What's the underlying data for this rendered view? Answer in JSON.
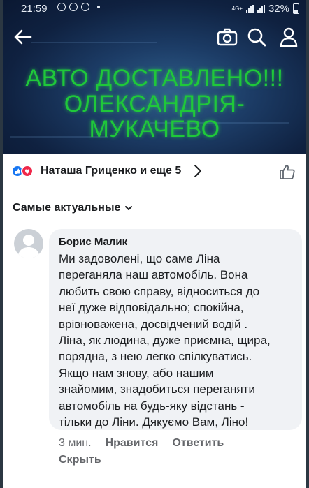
{
  "status_bar": {
    "time": "21:59",
    "network_label": "4G+",
    "battery": "32%"
  },
  "photo": {
    "line1": "АВТО  ДОСТАВЛЕНО!!!",
    "line2": "ОЛЕКСАНДРІЯ-МУКАЧЕВО",
    "text_color": "#1fc83a"
  },
  "toolbar": {
    "icons": [
      "back-arrow-icon",
      "camera-icon",
      "search-icon",
      "profile-icon"
    ]
  },
  "reactions": {
    "names": "Наташа Гриценко и еще 5",
    "like_color": "#1877f2",
    "love_color": "#f0284a"
  },
  "sort": {
    "label": "Самые актуальные"
  },
  "comment": {
    "author": "Борис Малик",
    "lines": [
      "Ми задоволені, що саме Ліна",
      "переганяла наш автомобіль. Вона",
      "любить свою справу, відноситься до",
      "неї дуже відповідально; спокійна,",
      "врівноважена, досвідчений водій .",
      "Ліна, як людина, дуже приємна, щира,",
      "порядна, з нею легко спілкуватись.",
      "Якщо нам знову, або нашим",
      "знайомим, знадобиться переганяти",
      "автомобіль на будь-яку відстань -",
      "тільки до Ліни. Дякуємо Вам, Ліно!"
    ],
    "time": "3 мин.",
    "like_label": "Нравится",
    "reply_label": "Ответить",
    "hide_label": "Скрыть"
  }
}
